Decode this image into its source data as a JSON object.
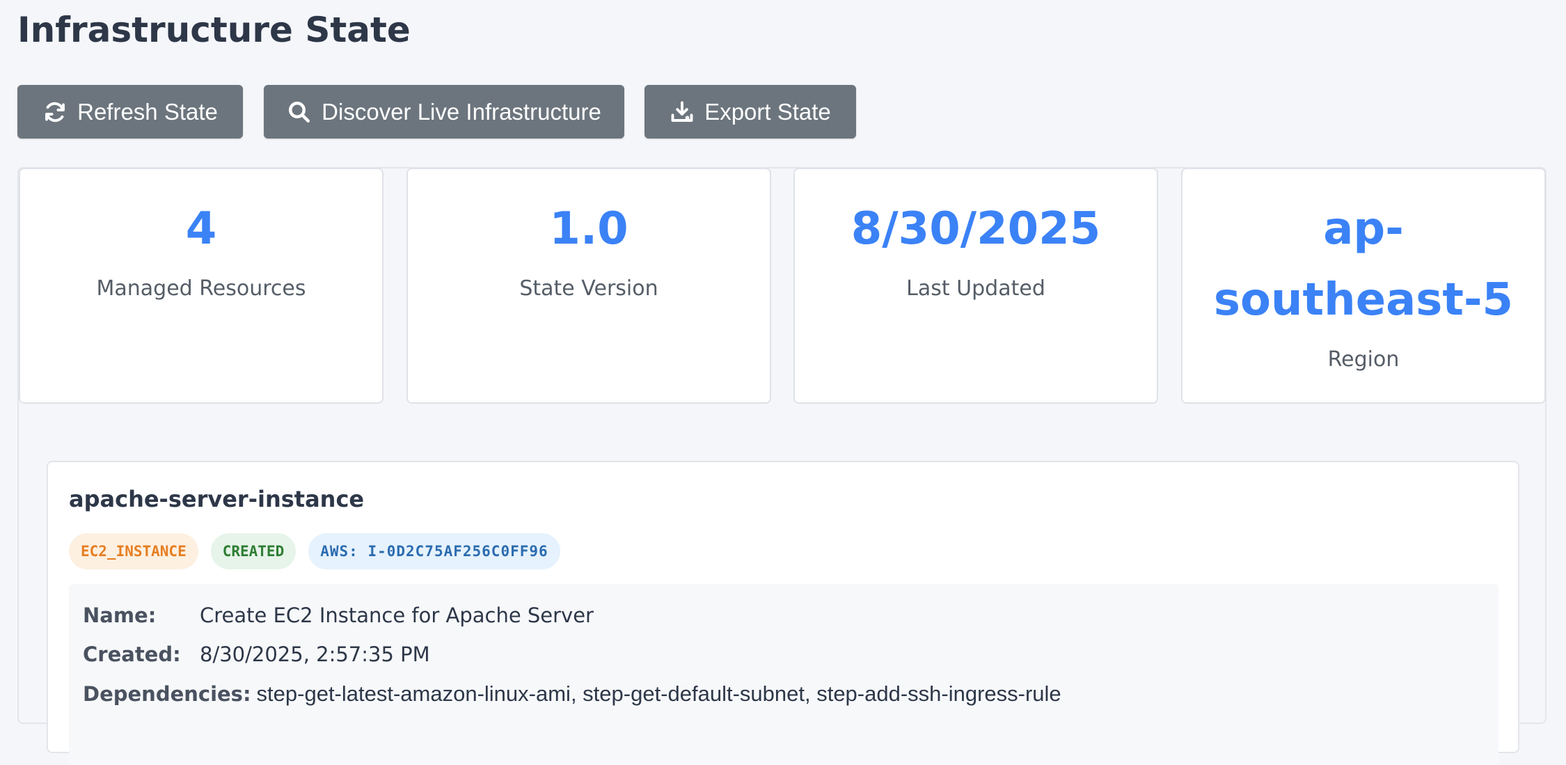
{
  "page": {
    "title": "Infrastructure State"
  },
  "toolbar": {
    "refresh_label": "Refresh State",
    "discover_label": "Discover Live Infrastructure",
    "export_label": "Export State"
  },
  "stats": [
    {
      "value": "4",
      "label": "Managed Resources"
    },
    {
      "value": "1.0",
      "label": "State Version"
    },
    {
      "value": "8/30/2025",
      "label": "Last Updated"
    },
    {
      "value_line1": "ap-",
      "value_line2": "southeast-5",
      "label": "Region"
    }
  ],
  "resource": {
    "name": "apache-server-instance",
    "type_badge": "EC2_INSTANCE",
    "status_badge": "CREATED",
    "aws_badge": "AWS: I-0D2C75AF256C0FF96",
    "details": {
      "name_label": "Name:",
      "name_value": "Create EC2 Instance for Apache Server",
      "created_label": "Created:",
      "created_value": "8/30/2025, 2:57:35 PM",
      "deps_label": "Dependencies:",
      "deps_value": "step-get-latest-amazon-linux-ami, step-get-default-subnet, step-add-ssh-ingress-rule"
    }
  },
  "colors": {
    "accent": "#3b82f6",
    "button_bg": "#6c757d",
    "type_badge": "#e67e22",
    "status_badge": "#2e7d32",
    "aws_badge": "#2b6cb0"
  },
  "icons": [
    "refresh-icon",
    "search-icon",
    "download-icon"
  ]
}
